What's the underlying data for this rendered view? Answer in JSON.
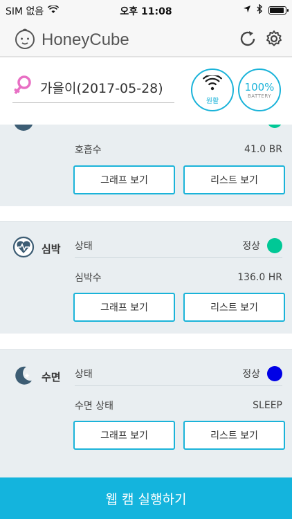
{
  "status_bar": {
    "carrier": "SIM 없음",
    "time": "오후 11:08",
    "wifi_icon": "wifi-icon",
    "location_icon": "location-arrow-icon",
    "bluetooth_icon": "bluetooth-icon"
  },
  "navbar": {
    "app_title": "HoneyCube",
    "logo_icon": "baby-face-icon",
    "refresh_icon": "refresh-icon",
    "settings_icon": "gear-icon"
  },
  "profile": {
    "name": "가을이(2017-05-28)",
    "gender_icon": "female-symbol-icon",
    "wifi_status": {
      "icon": "wifi-icon",
      "label": "원활"
    },
    "battery_status": {
      "value": "100%",
      "label": "BATTERY"
    }
  },
  "cards": [
    {
      "title": "",
      "status_color": "#00c896",
      "rows": [
        {
          "label": "호흡수",
          "value": "41.0 BR"
        }
      ],
      "graph_btn": "그래프 보기",
      "list_btn": "리스트 보기"
    },
    {
      "title": "심박",
      "icon": "heart-pulse-icon",
      "rows": [
        {
          "label": "상태",
          "value": "정상"
        },
        {
          "label": "심박수",
          "value": "136.0 HR"
        }
      ],
      "status_color": "#00c896",
      "graph_btn": "그래프 보기",
      "list_btn": "리스트 보기"
    },
    {
      "title": "수면",
      "icon": "moon-stars-icon",
      "rows": [
        {
          "label": "상태",
          "value": "정상"
        },
        {
          "label": "수면 상태",
          "value": "SLEEP"
        }
      ],
      "status_color": "#0000e6",
      "graph_btn": "그래프 보기",
      "list_btn": "리스트 보기"
    }
  ],
  "bottom_button": {
    "label": "웹 캠 실행하기"
  },
  "colors": {
    "accent": "#14b4dd",
    "card_bg": "#e9eef1"
  }
}
